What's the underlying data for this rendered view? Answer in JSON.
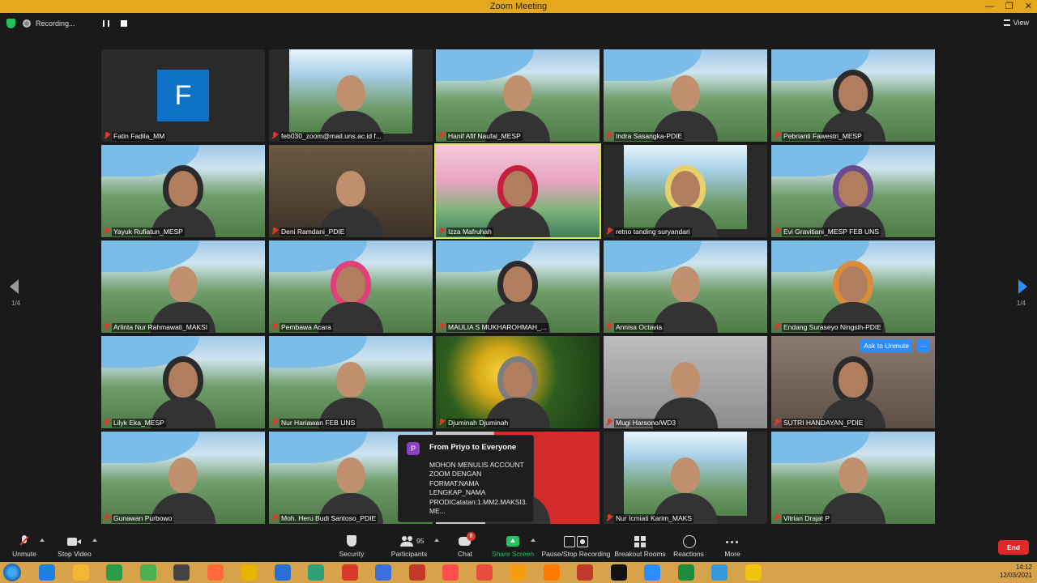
{
  "window": {
    "title": "Zoom Meeting"
  },
  "recording": {
    "label": "Recording..."
  },
  "view_label": "View",
  "pager": {
    "left": "1/4",
    "right": "1/4"
  },
  "tiles": [
    {
      "name": "Fatin Fadila_MM",
      "bg": "bg-dark",
      "avatar": "F"
    },
    {
      "name": "feb030_zoom@mail.uns.ac.id f...",
      "bg": "bg-dark",
      "slide": true,
      "person": "plain"
    },
    {
      "name": "Hanif Afif Naufal_MESP",
      "bg": "bg-uns",
      "person": "plain"
    },
    {
      "name": "Indra Sasangka-PDIE",
      "bg": "bg-uns",
      "person": "plain"
    },
    {
      "name": "Pebrianti Fawestri_MESP",
      "bg": "bg-uns",
      "person": "hijab"
    },
    {
      "name": "Yayuk Rufiatun_MESP",
      "bg": "bg-uns",
      "person": "hijab"
    },
    {
      "name": "Deni Ramdani_PDIE",
      "bg": "bg-room",
      "person": "plain"
    },
    {
      "name": "Izza Mafruhah",
      "bg": "bg-blossom",
      "person": "hijab hijab-red",
      "highlight": true
    },
    {
      "name": "retno tanding suryandari",
      "bg": "bg-dark",
      "slide": true,
      "person": "hijab hijab-yellow"
    },
    {
      "name": "Evi Gravitiani_MESP FEB UNS",
      "bg": "bg-uns",
      "person": "hijab hijab-purple"
    },
    {
      "name": "Arlinta Nur Rahmawati_MAKSI",
      "bg": "bg-uns",
      "person": ""
    },
    {
      "name": "Pembawa Acara",
      "bg": "bg-uns",
      "person": "hijab hijab-pink"
    },
    {
      "name": "MAULIA S MUKHAROHMAH_...",
      "bg": "bg-uns",
      "person": "hijab"
    },
    {
      "name": "Annisa Octavia",
      "bg": "bg-uns",
      "person": "plain"
    },
    {
      "name": "Endang Suraseyo Ningsih-PDIE",
      "bg": "bg-uns",
      "person": "hijab hijab-orange"
    },
    {
      "name": "Lilyk Eka_MESP",
      "bg": "bg-uns",
      "person": "hijab"
    },
    {
      "name": "Nur Hariawan FEB UNS",
      "bg": "bg-uns",
      "person": "plain"
    },
    {
      "name": "Djuminah Djuminah",
      "bg": "bg-flower",
      "person": "hijab hijab-grey"
    },
    {
      "name": "Mugi Harsono/WD3",
      "bg": "bg-grey",
      "person": "plain"
    },
    {
      "name": "SUTRI HANDAYAN_PDIE",
      "bg": "bg-face",
      "person": "hijab",
      "ask": true
    },
    {
      "name": "Gunawan Purbowo",
      "bg": "bg-uns",
      "person": "plain"
    },
    {
      "name": "Moh. Heru Budi Santoso_PDIE",
      "bg": "bg-uns",
      "person": "plain"
    },
    {
      "name": "",
      "bg": "bg-red",
      "person": "plain"
    },
    {
      "name": "Nur Icmiati Karim_MAKS",
      "bg": "bg-dark",
      "slide": true,
      "person": "plain"
    },
    {
      "name": "Vitrian Drajat P",
      "bg": "bg-uns",
      "person": "plain"
    }
  ],
  "ask_unmute": {
    "label": "Ask to Unmute",
    "more": "···"
  },
  "chat_popup": {
    "avatar_letter": "P",
    "from": "From Priyo to Everyone",
    "message": "MOHON MENULIS ACCOUNT ZOOM DENGAN FORMAT:NAMA LENGKAP_NAMA PRODICatatan:1.MM2.MAKSI3. ME..."
  },
  "toolbar": {
    "unmute": "Unmute",
    "stop_video": "Stop Video",
    "security": "Security",
    "participants_count": "95",
    "participants": "Participants",
    "chat_badge": "8",
    "chat": "Chat",
    "share_screen": "Share Screen",
    "pause_recording": "Pause/Stop Recording",
    "breakout_rooms": "Breakout Rooms",
    "reactions": "Reactions",
    "more": "More",
    "end": "End"
  },
  "taskbar": {
    "icon_colors": [
      "#1f7fe0",
      "#f2b632",
      "#2a9d4a",
      "#4caf50",
      "#444",
      "#ff6a3d",
      "#e8b400",
      "#2a6fd6",
      "#2e9e7b",
      "#d83a2a",
      "#3b6fe0",
      "#c0392b",
      "#ff4d4d",
      "#e74c3c",
      "#f39c12",
      "#ff7a00",
      "#c0392b",
      "#111",
      "#2d8cff",
      "#1e8e3e",
      "#3498db",
      "#f1c40f"
    ],
    "time": "14:12",
    "date": "12/03/2021"
  }
}
